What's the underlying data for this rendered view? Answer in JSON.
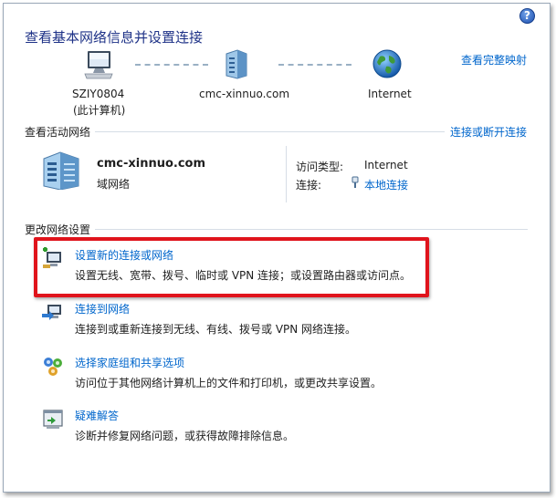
{
  "header": {
    "title": "查看基本网络信息并设置连接",
    "full_map_link": "查看完整映射",
    "help_glyph": "?"
  },
  "network_map": {
    "computer_name": "SZIY0804",
    "computer_sub": "(此计算机)",
    "network_name": "cmc-xinnuo.com",
    "internet_label": "Internet"
  },
  "active_networks": {
    "header": "查看活动网络",
    "connect_link": "连接或断开连接",
    "network_name": "cmc-xinnuo.com",
    "network_type": "域网络",
    "access_type_label": "访问类型:",
    "access_type_value": "Internet",
    "connections_label": "连接:",
    "connection_value": "本地连接"
  },
  "change_settings": {
    "header": "更改网络设置",
    "tasks": [
      {
        "title": "设置新的连接或网络",
        "desc": "设置无线、宽带、拨号、临时或 VPN 连接；或设置路由器或访问点。"
      },
      {
        "title": "连接到网络",
        "desc": "连接到或重新连接到无线、有线、拨号或 VPN 网络连接。"
      },
      {
        "title": "选择家庭组和共享选项",
        "desc": "访问位于其他网络计算机上的文件和打印机，或更改共享设置。"
      },
      {
        "title": "疑难解答",
        "desc": "诊断并修复网络问题，或获得故障排除信息。"
      }
    ]
  },
  "colors": {
    "link": "#0066cc",
    "title": "#1e3287",
    "highlight": "#e0141c"
  },
  "icons": [
    "computer-icon",
    "network-icon",
    "globe-icon",
    "building-network-icon",
    "ethernet-icon",
    "new-connection-icon",
    "connect-network-icon",
    "homegroup-icon",
    "troubleshoot-icon",
    "help-icon"
  ]
}
